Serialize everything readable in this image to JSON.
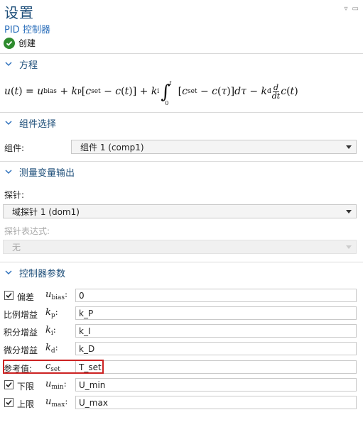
{
  "header": {
    "title": "设置",
    "subtitle": "PID 控制器",
    "create_label": "创建"
  },
  "sections": {
    "equation": {
      "label": "方程"
    },
    "component": {
      "label": "组件选择",
      "field_label": "组件:",
      "selected": "组件 1 (comp1)"
    },
    "probe": {
      "label": "测量变量输出",
      "probe_label": "探针:",
      "probe_selected": "域探针 1 (dom1)",
      "expr_label": "探针表达式:",
      "expr_selected": "无"
    },
    "controller": {
      "label": "控制器参数"
    }
  },
  "params": [
    {
      "label": "偏差",
      "checked": true,
      "sym": "u",
      "sub": "bias",
      "value": "0"
    },
    {
      "label": "比例增益",
      "checked": false,
      "sym": "k",
      "sub": "p",
      "value": "k_P"
    },
    {
      "label": "积分增益",
      "checked": false,
      "sym": "k",
      "sub": "i",
      "value": "k_I"
    },
    {
      "label": "微分增益",
      "checked": false,
      "sym": "k",
      "sub": "d",
      "value": "k_D"
    },
    {
      "label": "参考值:",
      "checked": false,
      "sym": "c",
      "sub": "set",
      "value": "T_set"
    },
    {
      "label": "下限",
      "checked": true,
      "sym": "u",
      "sub": "min",
      "value": "U_min"
    },
    {
      "label": "上限",
      "checked": true,
      "sym": "u",
      "sub": "max",
      "value": "U_max"
    }
  ],
  "colors": {
    "title": "#1d4e79",
    "accent": "#2a6ebb",
    "check_green": "#2e8b2e",
    "highlight": "#cc2222"
  }
}
